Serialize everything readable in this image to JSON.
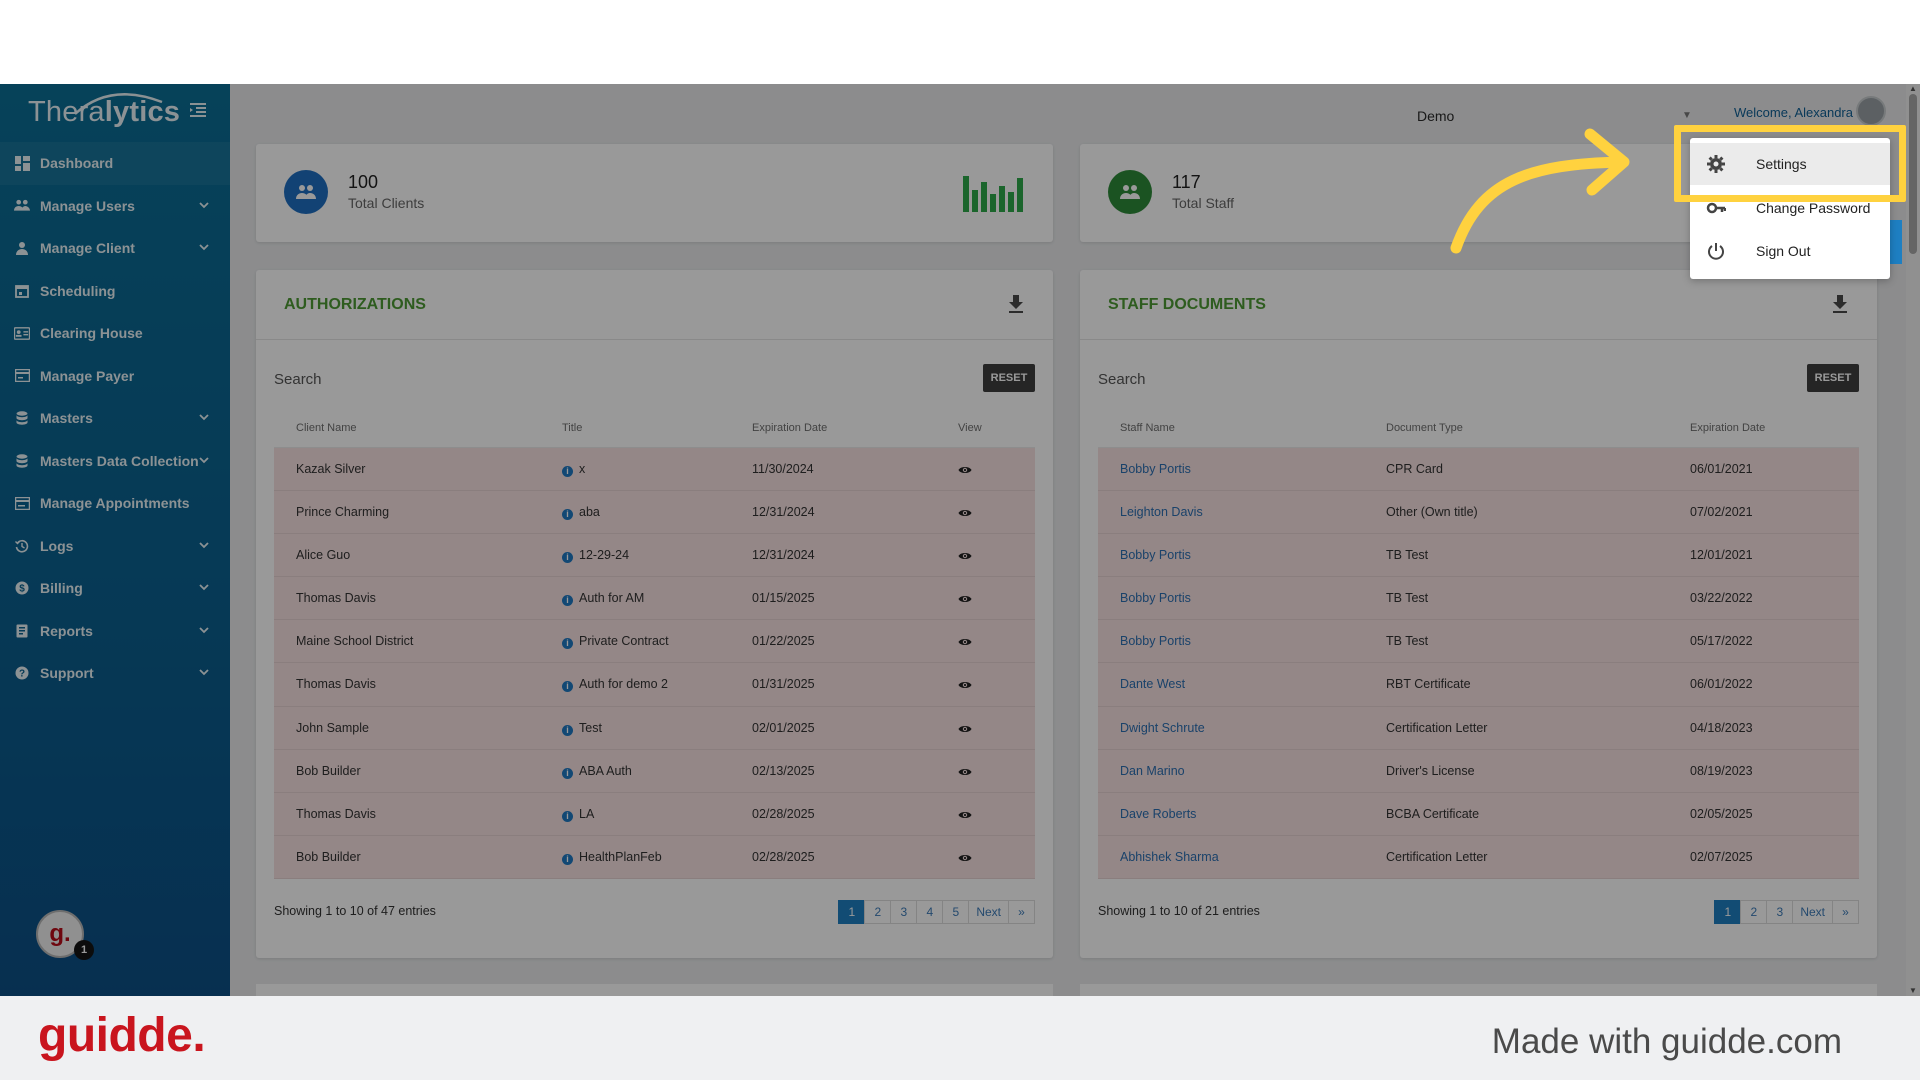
{
  "app": {
    "logo_text_a": "Thera",
    "logo_text_b": "lytics",
    "environment": "Demo",
    "welcome": "Welcome, Alexandra"
  },
  "sidebar": {
    "items": [
      {
        "label": "Dashboard",
        "icon": "dashboard-icon",
        "chevron": false
      },
      {
        "label": "Manage Users",
        "icon": "users-icon",
        "chevron": true
      },
      {
        "label": "Manage Client",
        "icon": "person-icon",
        "chevron": true
      },
      {
        "label": "Scheduling",
        "icon": "calendar-icon",
        "chevron": false
      },
      {
        "label": "Clearing House",
        "icon": "id-card-icon",
        "chevron": false
      },
      {
        "label": "Manage Payer",
        "icon": "payer-icon",
        "chevron": false
      },
      {
        "label": "Masters",
        "icon": "database-icon",
        "chevron": true
      },
      {
        "label": "Masters Data Collection",
        "icon": "database-icon",
        "chevron": true
      },
      {
        "label": "Manage Appointments",
        "icon": "appointments-icon",
        "chevron": false
      },
      {
        "label": "Logs",
        "icon": "history-icon",
        "chevron": true
      },
      {
        "label": "Billing",
        "icon": "dollar-icon",
        "chevron": true
      },
      {
        "label": "Reports",
        "icon": "report-icon",
        "chevron": true
      },
      {
        "label": "Support",
        "icon": "help-icon",
        "chevron": true
      }
    ],
    "help_avatar_letter": "g.",
    "help_badge": "1"
  },
  "stats": {
    "clients": {
      "value": "100",
      "label": "Total Clients",
      "color": "#1e6fc2"
    },
    "staff": {
      "value": "117",
      "label": "Total Staff",
      "color": "#2e8b3a"
    }
  },
  "authorizations": {
    "title": "AUTHORIZATIONS",
    "search_placeholder": "Search",
    "reset_label": "RESET",
    "columns": [
      "Client Name",
      "Title",
      "Expiration Date",
      "View"
    ],
    "rows": [
      {
        "client": "Kazak Silver",
        "title": "x",
        "expiration": "11/30/2024"
      },
      {
        "client": "Prince Charming",
        "title": "aba",
        "expiration": "12/31/2024"
      },
      {
        "client": "Alice Guo",
        "title": "12-29-24",
        "expiration": "12/31/2024"
      },
      {
        "client": "Thomas Davis",
        "title": "Auth for AM",
        "expiration": "01/15/2025"
      },
      {
        "client": "Maine School District",
        "title": "Private Contract",
        "expiration": "01/22/2025"
      },
      {
        "client": "Thomas Davis",
        "title": "Auth for demo 2",
        "expiration": "01/31/2025"
      },
      {
        "client": "John Sample",
        "title": "Test",
        "expiration": "02/01/2025"
      },
      {
        "client": "Bob Builder",
        "title": "ABA Auth",
        "expiration": "02/13/2025"
      },
      {
        "client": "Thomas Davis",
        "title": "LA",
        "expiration": "02/28/2025"
      },
      {
        "client": "Bob Builder",
        "title": "HealthPlanFeb",
        "expiration": "02/28/2025"
      }
    ],
    "showing": "Showing 1 to 10 of 47 entries",
    "pages": [
      "1",
      "2",
      "3",
      "4",
      "5",
      "Next",
      "»"
    ]
  },
  "staff_documents": {
    "title": "STAFF DOCUMENTS",
    "search_placeholder": "Search",
    "reset_label": "RESET",
    "columns": [
      "Staff Name",
      "Document Type",
      "Expiration Date"
    ],
    "rows": [
      {
        "staff": "Bobby Portis",
        "doc": "CPR Card",
        "expiration": "06/01/2021"
      },
      {
        "staff": "Leighton Davis",
        "doc": "Other (Own title)",
        "expiration": "07/02/2021"
      },
      {
        "staff": "Bobby Portis",
        "doc": "TB Test",
        "expiration": "12/01/2021"
      },
      {
        "staff": "Bobby Portis",
        "doc": "TB Test",
        "expiration": "03/22/2022"
      },
      {
        "staff": "Bobby Portis",
        "doc": "TB Test",
        "expiration": "05/17/2022"
      },
      {
        "staff": "Dante West",
        "doc": "RBT Certificate",
        "expiration": "06/01/2022"
      },
      {
        "staff": "Dwight Schrute",
        "doc": "Certification Letter",
        "expiration": "04/18/2023"
      },
      {
        "staff": "Dan Marino",
        "doc": "Driver's License",
        "expiration": "08/19/2023"
      },
      {
        "staff": "Dave Roberts",
        "doc": "BCBA Certificate",
        "expiration": "02/05/2025"
      },
      {
        "staff": "Abhishek Sharma",
        "doc": "Certification Letter",
        "expiration": "02/07/2025"
      }
    ],
    "showing": "Showing 1 to 10 of 21 entries",
    "pages": [
      "1",
      "2",
      "3",
      "Next",
      "»"
    ]
  },
  "user_menu": {
    "settings": "Settings",
    "change_password": "Change Password",
    "sign_out": "Sign Out"
  },
  "footer": {
    "brand": "guidde.",
    "made_with": "Made with guidde.com"
  },
  "colors": {
    "sidebar": "#0b6390",
    "accent_green": "#4d9a34",
    "pager_active": "#1e7fc2",
    "highlight": "#ffd23f",
    "brand_red": "#c9151e"
  }
}
